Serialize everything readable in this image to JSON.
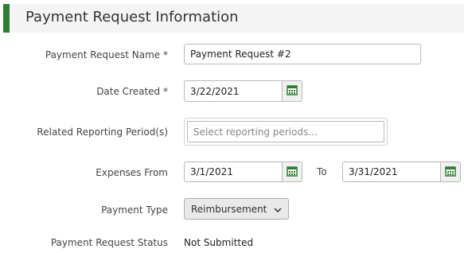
{
  "section": {
    "title": "Payment Request Information"
  },
  "fields": {
    "name": {
      "label": "Payment Request Name *",
      "value": "Payment Request #2"
    },
    "date_created": {
      "label": "Date Created *",
      "value": "3/22/2021"
    },
    "reporting_periods": {
      "label": "Related Reporting Period(s)",
      "placeholder": "Select reporting periods..."
    },
    "expenses": {
      "label": "Expenses From",
      "from_value": "3/1/2021",
      "to_label": "To",
      "to_value": "3/31/2021"
    },
    "payment_type": {
      "label": "Payment Type",
      "value": "Reimbursement"
    },
    "status": {
      "label": "Payment Request Status",
      "value": "Not Submitted"
    }
  },
  "icons": {
    "calendar": "calendar-icon",
    "dropdown": "chevron-down-icon"
  },
  "colors": {
    "accent": "#2e7d32",
    "calendar": "#2e7d32"
  }
}
